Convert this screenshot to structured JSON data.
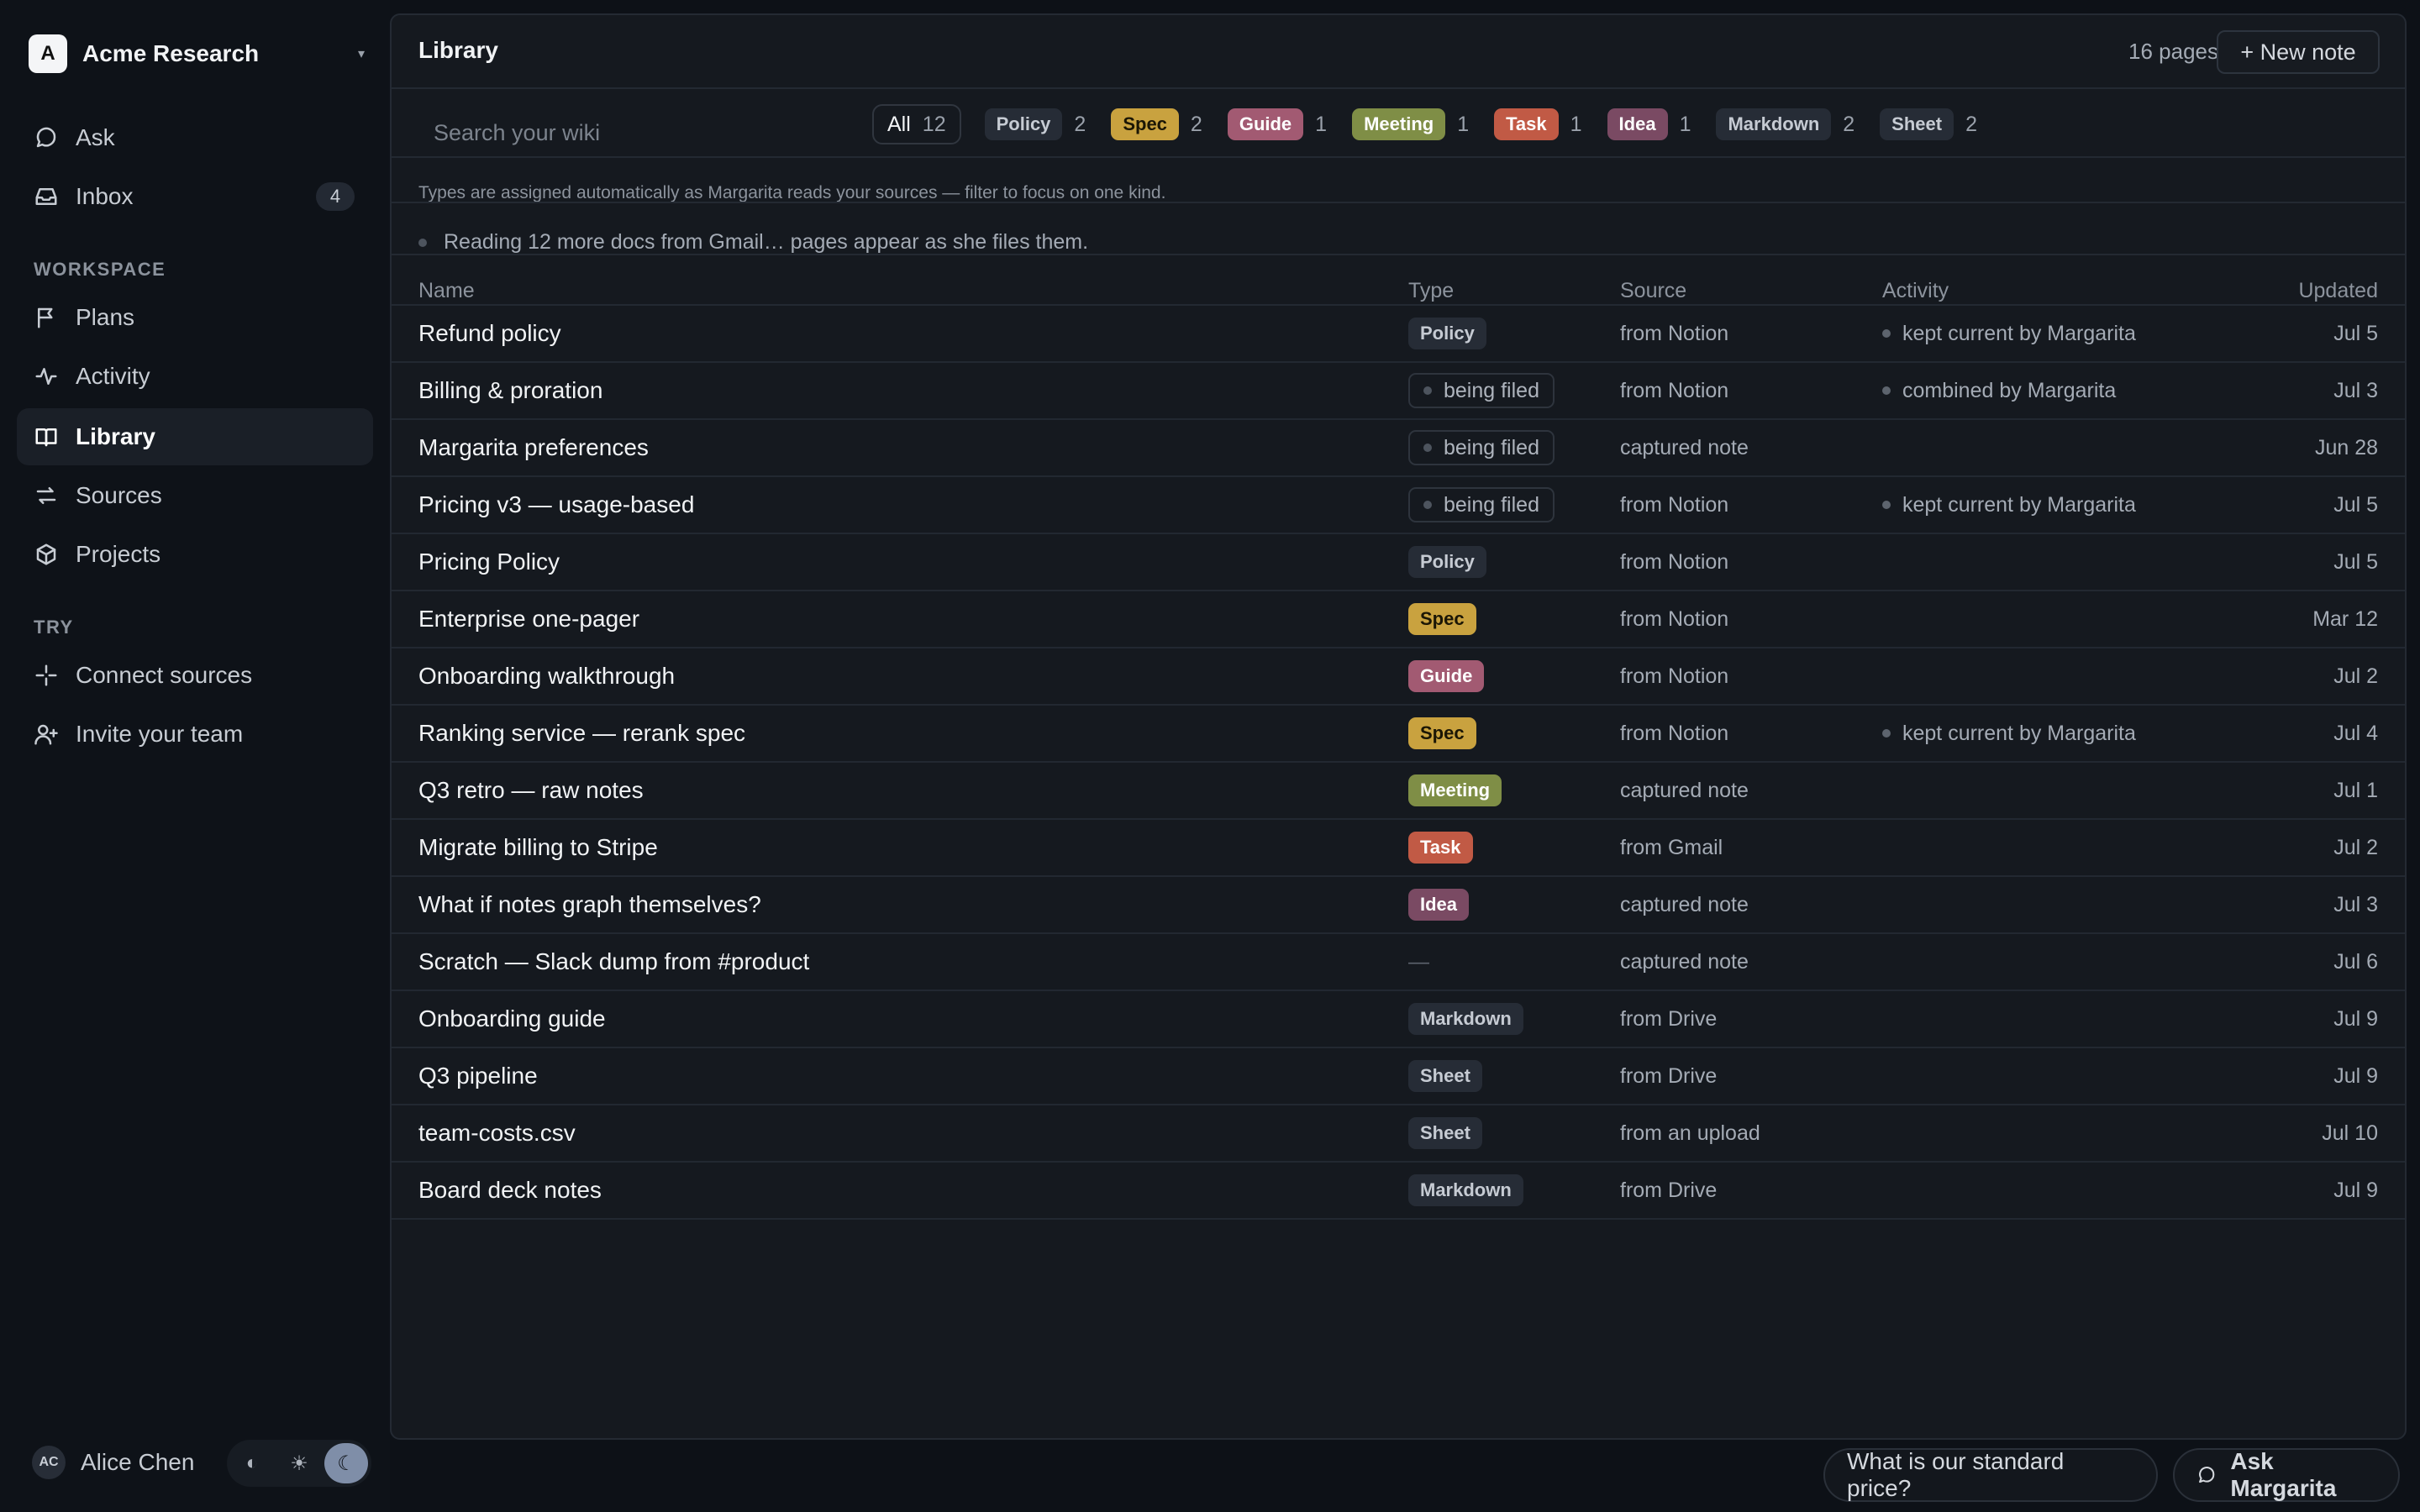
{
  "workspace": {
    "logo_letter": "A",
    "name": "Acme Research",
    "caret": "▾"
  },
  "nav": {
    "ask": "Ask",
    "inbox": "Inbox",
    "inbox_count": "4",
    "workspace_label": "WORKSPACE",
    "plans": "Plans",
    "activity": "Activity",
    "library": "Library",
    "sources": "Sources",
    "projects": "Projects",
    "try_label": "TRY",
    "connect_sources": "Connect sources",
    "invite_team": "Invite your team"
  },
  "user": {
    "initials": "AC",
    "name": "Alice Chen"
  },
  "theme": {
    "auto": "◐",
    "light": "☀",
    "dark": "☾"
  },
  "header": {
    "title": "Library",
    "page_count": "16 pages",
    "new_note": "+ New note"
  },
  "search": {
    "placeholder": "Search your wiki"
  },
  "filters": {
    "all_label": "All",
    "all_count": "12",
    "items": [
      {
        "label": "Policy",
        "count": "2"
      },
      {
        "label": "Spec",
        "count": "2"
      },
      {
        "label": "Guide",
        "count": "1"
      },
      {
        "label": "Meeting",
        "count": "1"
      },
      {
        "label": "Task",
        "count": "1"
      },
      {
        "label": "Idea",
        "count": "1"
      },
      {
        "label": "Markdown",
        "count": "2"
      },
      {
        "label": "Sheet",
        "count": "2"
      }
    ]
  },
  "hint": "Types are assigned automatically as Margarita reads your sources — filter to focus on one kind.",
  "reading": "Reading 12 more docs from Gmail… pages appear as she files them.",
  "columns": {
    "name": "Name",
    "type": "Type",
    "source": "Source",
    "activity": "Activity",
    "updated": "Updated"
  },
  "rows": [
    {
      "name": "Refund policy",
      "type": "Policy",
      "source": "from Notion",
      "activity": "kept current by Margarita",
      "updated": "Jul 5"
    },
    {
      "name": "Billing & proration",
      "type": "being filed",
      "source": "from Notion",
      "activity": "combined by Margarita",
      "updated": "Jul 3"
    },
    {
      "name": "Margarita preferences",
      "type": "being filed",
      "source": "captured note",
      "activity": "",
      "updated": "Jun 28"
    },
    {
      "name": "Pricing v3 — usage-based",
      "type": "being filed",
      "source": "from Notion",
      "activity": "kept current by Margarita",
      "updated": "Jul 5"
    },
    {
      "name": "Pricing Policy",
      "type": "Policy",
      "source": "from Notion",
      "activity": "",
      "updated": "Jul 5"
    },
    {
      "name": "Enterprise one-pager",
      "type": "Spec",
      "source": "from Notion",
      "activity": "",
      "updated": "Mar 12"
    },
    {
      "name": "Onboarding walkthrough",
      "type": "Guide",
      "source": "from Notion",
      "activity": "",
      "updated": "Jul 2"
    },
    {
      "name": "Ranking service — rerank spec",
      "type": "Spec",
      "source": "from Notion",
      "activity": "kept current by Margarita",
      "updated": "Jul 4"
    },
    {
      "name": "Q3 retro — raw notes",
      "type": "Meeting",
      "source": "captured note",
      "activity": "",
      "updated": "Jul 1"
    },
    {
      "name": "Migrate billing to Stripe",
      "type": "Task",
      "source": "from Gmail",
      "activity": "",
      "updated": "Jul 2"
    },
    {
      "name": "What if notes graph themselves?",
      "type": "Idea",
      "source": "captured note",
      "activity": "",
      "updated": "Jul 3"
    },
    {
      "name": "Scratch — Slack dump from #product",
      "type": "—",
      "source": "captured note",
      "activity": "",
      "updated": "Jul 6"
    },
    {
      "name": "Onboarding guide",
      "type": "Markdown",
      "source": "from Drive",
      "activity": "",
      "updated": "Jul 9"
    },
    {
      "name": "Q3 pipeline",
      "type": "Sheet",
      "source": "from Drive",
      "activity": "",
      "updated": "Jul 9"
    },
    {
      "name": "team-costs.csv",
      "type": "Sheet",
      "source": "from an upload",
      "activity": "",
      "updated": "Jul 10"
    },
    {
      "name": "Board deck notes",
      "type": "Markdown",
      "source": "from Drive",
      "activity": "",
      "updated": "Jul 9"
    }
  ],
  "bottom": {
    "suggestion": "What is our standard price?",
    "ask_button": "Ask Margarita"
  }
}
